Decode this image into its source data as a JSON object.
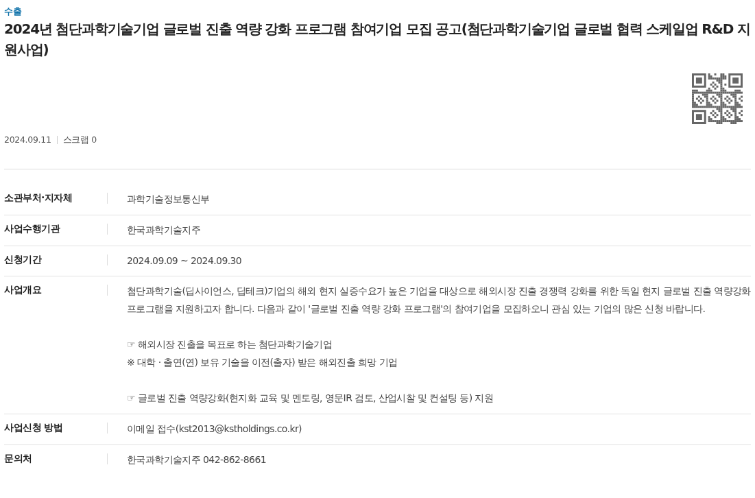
{
  "category": "수출",
  "title": "2024년 첨단과학기술기업 글로벌 진출 역량 강화 프로그램 참여기업 모집 공고(첨단과학기술기업 글로벌 협력 스케일업 R&D 지원사업)",
  "meta": {
    "date": "2024.09.11",
    "scrap": "스크랩 0"
  },
  "details": [
    {
      "label": "소관부처·지자체",
      "paragraphs": [
        [
          "과학기술정보통신부"
        ]
      ]
    },
    {
      "label": "사업수행기관",
      "paragraphs": [
        [
          "한국과학기술지주"
        ]
      ]
    },
    {
      "label": "신청기간",
      "paragraphs": [
        [
          "2024.09.09 ~ 2024.09.30"
        ]
      ]
    },
    {
      "label": "사업개요",
      "paragraphs": [
        [
          "첨단과학기술(딥사이언스, 딥테크)기업의 해외 현지 실증수요가 높은 기업을 대상으로 해외시장 진출 경쟁력 강화를 위한 독일 현지 글로벌 진출 역량강화 프로그램을 지원하고자 합니다. 다음과 같이 '글로벌 진출 역량 강화 프로그램'의 참여기업을 모집하오니 관심 있는 기업의 많은 신청 바랍니다."
        ],
        [
          "☞ 해외시장 진출을 목표로 하는 첨단과학기술기업",
          "※ 대학 · 출연(연) 보유 기술을 이전(출자) 받은 해외진출 희망 기업"
        ],
        [
          "☞ 글로벌 진출 역량강화(현지화 교육 및 멘토링, 영문IR 검토, 산업시찰 및 컨설팅 등) 지원"
        ]
      ]
    },
    {
      "label": "사업신청 방법",
      "paragraphs": [
        [
          "이메일 접수(kst2013@kstholdings.co.kr)"
        ]
      ]
    },
    {
      "label": "문의처",
      "paragraphs": [
        [
          "한국과학기술지주 042-862-8661"
        ]
      ]
    }
  ]
}
